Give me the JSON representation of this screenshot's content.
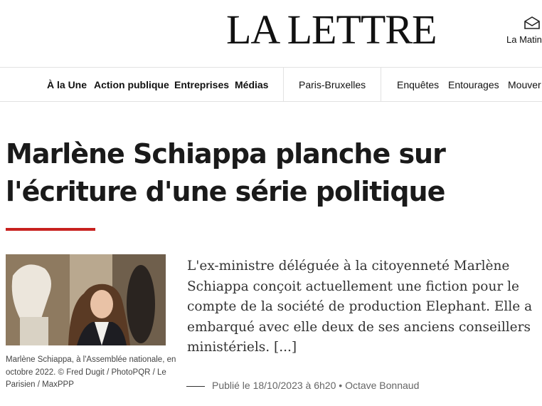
{
  "header": {
    "logo": "LA LETTRE",
    "matinale_label": "La Matin"
  },
  "nav": {
    "items": [
      "À la Une",
      "Action publique",
      "Entreprises",
      "Médias",
      "Paris-Bruxelles",
      "Enquêtes",
      "Entourages",
      "Mouver"
    ]
  },
  "article": {
    "title": "Marlène Schiappa planche sur l'écriture d'une série politique",
    "chapo": "L'ex-ministre déléguée à la citoyenneté Marlène Schiappa conçoit actuellement une fiction pour le compte de la société de production Elephant. Elle a embarqué avec elle deux de ses anciens conseillers ministériels. [...]",
    "caption": "Marlène Schiappa, à l'Assemblée nationale, en octobre 2022. © Fred Dugit / PhotoPQR / Le Parisien / MaxPPP",
    "published": "Publié le 18/10/2023 à 6h20",
    "author": "Octave Bonnaud"
  },
  "colors": {
    "accent": "#c8211f",
    "text": "#1a1a1a",
    "muted": "#666666"
  }
}
